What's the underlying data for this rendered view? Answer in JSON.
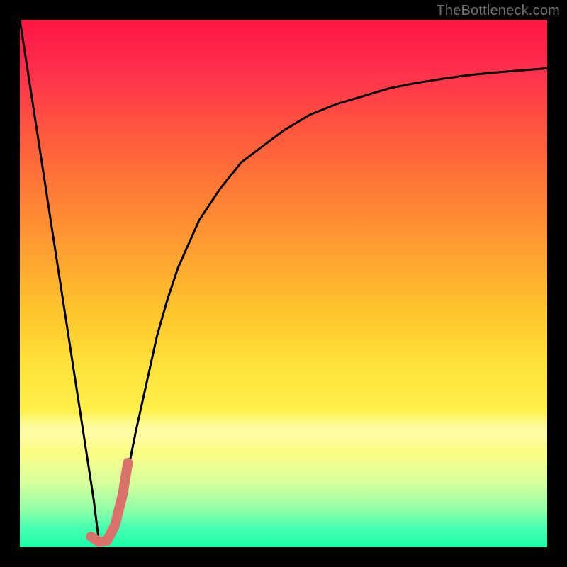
{
  "watermark": "TheBottleneck.com",
  "chart_data": {
    "type": "line",
    "title": "",
    "xlabel": "",
    "ylabel": "",
    "xlim": [
      0,
      100
    ],
    "ylim": [
      0,
      100
    ],
    "grid": false,
    "series": [
      {
        "name": "bottleneck-curve",
        "color": "#000000",
        "stroke_width": 3,
        "x": [
          0,
          2,
          4,
          6,
          8,
          10,
          12,
          14,
          15,
          16,
          18,
          20,
          22,
          24,
          26,
          28,
          30,
          34,
          38,
          42,
          46,
          50,
          55,
          60,
          65,
          70,
          75,
          80,
          85,
          90,
          95,
          100
        ],
        "y": [
          100,
          87,
          74,
          61,
          48,
          35,
          22,
          9,
          1,
          1,
          5,
          12,
          22,
          31,
          40,
          47,
          53,
          62,
          68,
          73,
          76,
          79,
          82,
          84,
          85.5,
          87,
          88,
          88.8,
          89.5,
          90,
          90.4,
          90.8
        ]
      },
      {
        "name": "highlight-segment",
        "color": "#d9726b",
        "stroke_width": 14,
        "linecap": "round",
        "x": [
          13.5,
          15.0,
          16.5,
          18.0,
          19.5,
          20.5
        ],
        "y": [
          2.0,
          1.0,
          1.2,
          4.0,
          10.0,
          16.0
        ]
      }
    ],
    "background_gradient": {
      "top": "#ff1744",
      "mid": "#ffd23a",
      "bottom": "#19ffa9"
    }
  }
}
